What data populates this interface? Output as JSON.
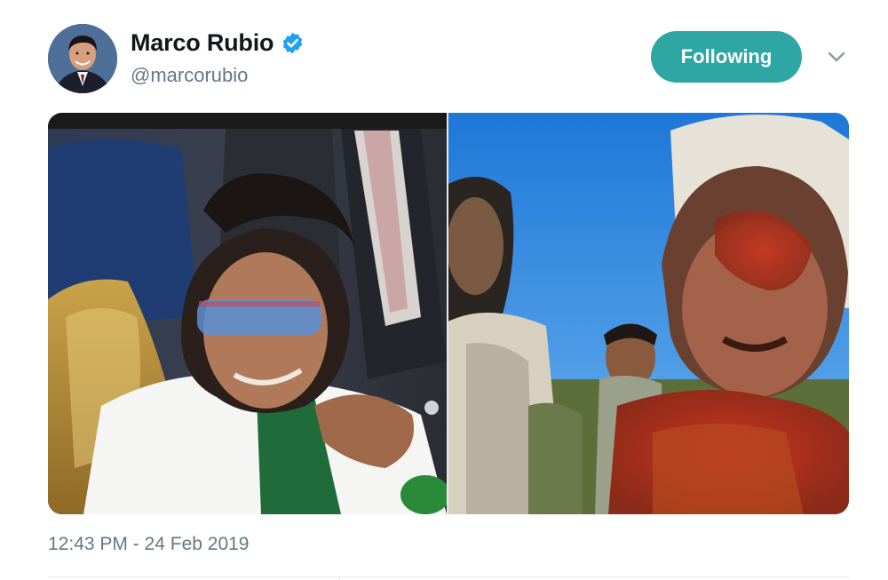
{
  "tweet": {
    "author": {
      "display_name": "Marco Rubio",
      "handle": "@marcorubio",
      "verified": true
    },
    "follow_button_label": "Following",
    "timestamp": "12:43 PM - 24 Feb 2019",
    "media": {
      "count": 2
    }
  },
  "icons": {
    "verified": "verified-badge-icon",
    "more": "chevron-down-icon"
  },
  "colors": {
    "accent": "#2ea6a3",
    "verified": "#1da1f2",
    "secondary_text": "#657786"
  }
}
